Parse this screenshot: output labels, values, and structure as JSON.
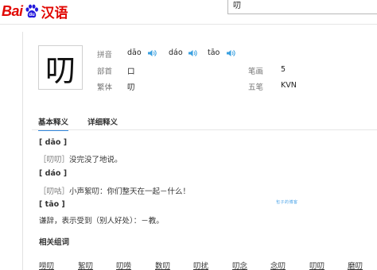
{
  "header": {
    "logo_bai": "Bai",
    "logo_hanyu": "汉语",
    "search_value": "叨"
  },
  "character": {
    "glyph": "叨",
    "pinyin_label": "拼音",
    "readings": [
      "dāo",
      "dáo",
      "tāo"
    ],
    "radical_label": "部首",
    "radical": "口",
    "strokes_label": "笔画",
    "strokes": "5",
    "traditional_label": "繁体",
    "traditional": "叨",
    "wubi_label": "五笔",
    "wubi": "KVN"
  },
  "tabs": [
    "基本释义",
    "详细释义"
  ],
  "definitions": [
    {
      "pinyin": "[ dāo ]",
      "term": "［叨叨］",
      "text": "没完没了地说。"
    },
    {
      "pinyin": "[ dáo ]",
      "term": "［叨咕］",
      "text": "小声絮叨：你们整天在一起－什么！"
    },
    {
      "pinyin": "[ tāo ]",
      "term": "",
      "text": "谦辞，表示受到（别人好处）：－教。"
    }
  ],
  "watermark": "包子的博客",
  "related": {
    "title": "相关组词",
    "words": [
      "唠叨",
      "絮叨",
      "叨唠",
      "数叨",
      "叨扰",
      "叨念",
      "念叨",
      "叨叨",
      "磨叨"
    ]
  },
  "colors": {
    "brand_red": "#e10601",
    "paw_blue": "#2319dc",
    "accent_blue": "#3388dd"
  }
}
